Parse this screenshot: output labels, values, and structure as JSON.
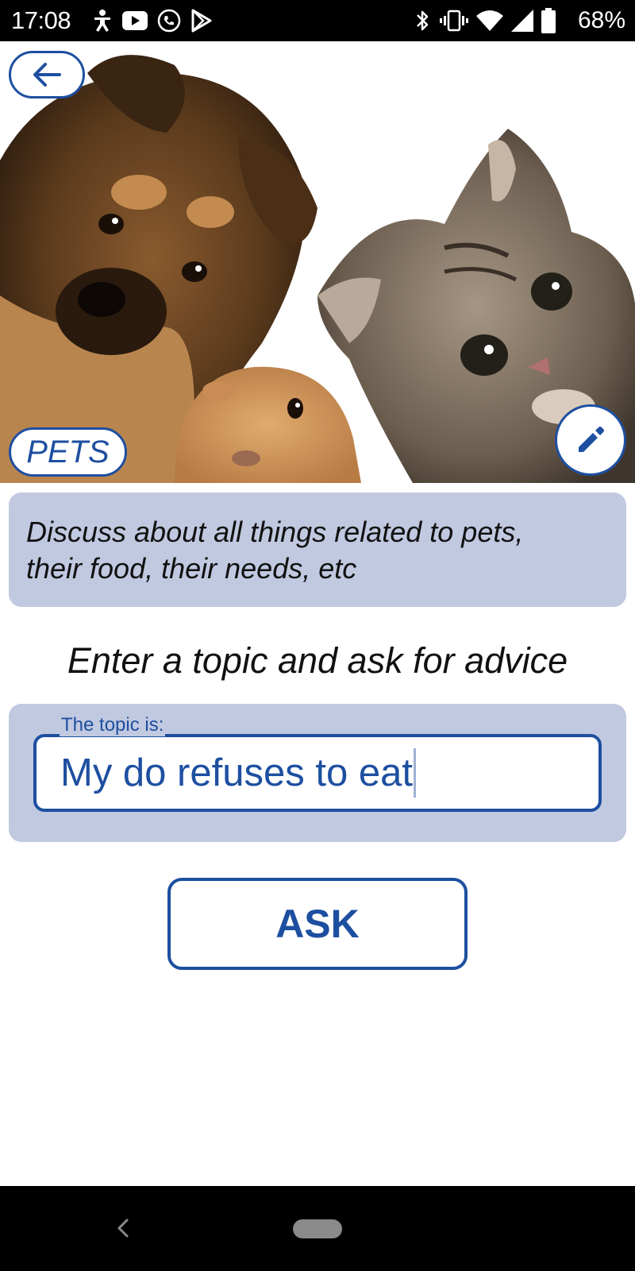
{
  "status_bar": {
    "time": "17:08",
    "battery_text": "68%",
    "left_icons": [
      "accessibility-icon",
      "youtube-icon",
      "phone-call-icon",
      "play-store-icon"
    ],
    "right_icons": [
      "bluetooth-icon",
      "vibrate-icon",
      "wifi-icon",
      "cellular-signal-icon",
      "battery-icon"
    ]
  },
  "header": {
    "back_icon": "arrow-left-icon",
    "edit_icon": "pencil-icon",
    "category": "PETS"
  },
  "description": {
    "line1": "Discuss about all things related to pets,",
    "line2": "their food, their needs, etc"
  },
  "prompt": {
    "heading": "Enter a topic and ask for advice"
  },
  "topic": {
    "label": "The topic is:",
    "value": "My do refuses to eat"
  },
  "actions": {
    "ask_label": "ASK"
  },
  "nav_bar": {
    "back_icon": "nav-back-icon",
    "home_icon": "home-pill-icon"
  },
  "colors": {
    "accent": "#1d4fa0",
    "card_background": "#c0c9e0",
    "bar_background": "#000000"
  }
}
